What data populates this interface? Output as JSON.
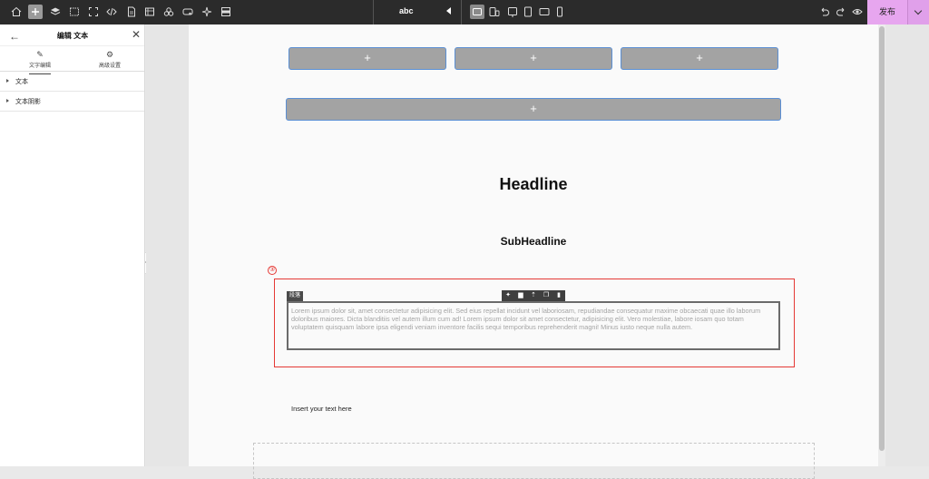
{
  "toolbar": {
    "left_tools": [
      "home-icon",
      "add-icon",
      "layers-icon",
      "select-icon",
      "fullscreen-icon",
      "code-icon",
      "page-icon",
      "gallery-icon",
      "assets-icon",
      "component-icon",
      "magic-icon",
      "template-icon"
    ],
    "site_name": "abc",
    "devices": [
      "desktop-icon",
      "tablet-mobile-icon",
      "tablet-icon",
      "tablet-portrait-icon",
      "tablet-landscape-icon",
      "mobile-icon"
    ],
    "right_tools": [
      "undo-icon",
      "redo-icon",
      "preview-icon"
    ],
    "publish_label": "发布",
    "publish_color": "#e7a6ef"
  },
  "panel": {
    "title": "编辑 文本",
    "tabs": [
      {
        "label": "文字编辑",
        "icon": "pencil-icon"
      },
      {
        "label": "高级设置",
        "icon": "gear-icon"
      }
    ],
    "sections": [
      "文本",
      "文本阴影"
    ]
  },
  "canvas": {
    "placeholder_label": "+",
    "headline": "Headline",
    "subheadline": "SubHeadline",
    "step_badge": "③",
    "paragraph_tag": "段落",
    "paragraph_text": "Lorem ipsum dolor sit, amet consectetur adipisicing elit. Sed eius repellat incidunt vel laboriosam, repudiandae consequatur maxime obcaecati quae illo laborum doloribus maiores. Dicta blanditiis vel autem illum cum ad! Lorem ipsum dolor sit amet consectetur, adipisicing elit. Vero molestiae, labore iosam quo totam voluptatem quisquam labore ipsa eligendi veniam inventore facilis sequi temporibus reprehenderit magni! Minus iusto neque nulla autem.",
    "insert_text": "Insert your text here",
    "highlight_color": "#e53935"
  }
}
